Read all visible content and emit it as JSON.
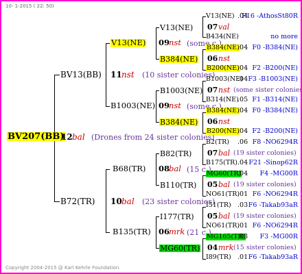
{
  "header": {
    "date": "10-  1-2015 ( 22: 50)"
  },
  "footer": {
    "copyright": "Copyright 2004-2015 @ Karl Kehrle Foundation."
  },
  "root": {
    "name": "BV207(BB)",
    "num": "12",
    "breeder": "bal",
    "note": "(Drones from 24 sister colonies)"
  },
  "gen1": {
    "upper": {
      "name": "BV13(BB)",
      "num": "11",
      "breeder": "nst",
      "note": "(10 sister colonies)"
    },
    "lower": {
      "name": "B72(TR)",
      "num": "10",
      "breeder": "bal",
      "note": "(23 sister colonies)"
    }
  },
  "gen2": {
    "a": {
      "name": "V13(NE)",
      "num": "09",
      "breeder": "nst",
      "note": "(some c.)"
    },
    "b": {
      "name": "B1003(NE)",
      "num": "09",
      "breeder": "nst",
      "note": "(some c.)"
    },
    "c": {
      "name": "B68(TR)",
      "num": "08",
      "breeder": "bal",
      "note": "(15 c.)"
    },
    "d": {
      "name": "B135(TR)",
      "num": "06",
      "breeder": "mrk",
      "note": "(21 c.)"
    }
  },
  "gen3": {
    "a1": "V13(NE)",
    "a2": "B384(NE)",
    "b1": "B1003(NE)",
    "b2": "B384(NE)",
    "c1": "B82(TR)",
    "c2": "B110(TR)",
    "d1": "I177(TR)",
    "d2": "MG60(TR)"
  },
  "gen4": [
    {
      "kind": "top",
      "name": "V13(NE)",
      "y": ".04",
      "origin": "F16 -AthosSt80R"
    },
    {
      "kind": "mid",
      "num": "07",
      "breeder": "val",
      "note": ""
    },
    {
      "kind": "bot",
      "name": "B434(NE)",
      "y": "",
      "origin": "no more"
    },
    {
      "kind": "top",
      "name": "B384(NE)",
      "y": ".04",
      "origin": "F0 -B384(NE)"
    },
    {
      "kind": "mid",
      "num": "06",
      "breeder": "nst",
      "note": ""
    },
    {
      "kind": "bot",
      "name": "B200(NE)",
      "y": ".04",
      "origin": "F2 -B200(NE)"
    },
    {
      "kind": "top",
      "name": "B1003(NE)",
      "y": ".04",
      "origin": "F3 -B1003(NE)"
    },
    {
      "kind": "mid",
      "num": "07",
      "breeder": "nst",
      "note": "(some sister colonies)"
    },
    {
      "kind": "bot",
      "name": "B314(NE)",
      "y": ".05",
      "origin": "F1 -B314(NE)"
    },
    {
      "kind": "top",
      "name": "B384(NE)",
      "y": ".04",
      "origin": "F0 -B384(NE)"
    },
    {
      "kind": "mid",
      "num": "06",
      "breeder": "nst",
      "note": ""
    },
    {
      "kind": "bot",
      "name": "B200(NE)",
      "y": ".04",
      "origin": "F2 -B200(NE)"
    },
    {
      "kind": "top",
      "name": "B2(TR)",
      "y": ".06",
      "origin": "F8 -NO6294R"
    },
    {
      "kind": "mid",
      "num": "07",
      "breeder": "bal",
      "note": "(19 sister colonies)"
    },
    {
      "kind": "bot",
      "name": "B175(TR)",
      "y": ".04",
      "origin": "F21 -Sinop62R"
    },
    {
      "kind": "top",
      "name": "MG60(TR)",
      "y": ".04",
      "origin": "F4 -MG00R"
    },
    {
      "kind": "mid",
      "num": "05",
      "breeder": "bal",
      "note": "(19 sister colonies)"
    },
    {
      "kind": "bot",
      "name": "NO61(TR)",
      "y": ".01",
      "origin": "F6 -NO6294R"
    },
    {
      "kind": "top",
      "name": "I51(TR)",
      "y": ".03",
      "origin": "F6 -Takab93aR"
    },
    {
      "kind": "mid",
      "num": "05",
      "breeder": "bal",
      "note": "(19 sister colonies)"
    },
    {
      "kind": "bot",
      "name": "NO61(TR)",
      "y": ".01",
      "origin": "F6 -NO6294R"
    },
    {
      "kind": "top",
      "name": "MG165(TR)",
      "y": ".03",
      "origin": "F3 -MG00R"
    },
    {
      "kind": "mid",
      "num": "04",
      "breeder": "mrk",
      "note": "(15 sister colonies)"
    },
    {
      "kind": "bot",
      "name": "I89(TR)",
      "y": ".01",
      "origin": "F6 -Takab93aR"
    }
  ]
}
